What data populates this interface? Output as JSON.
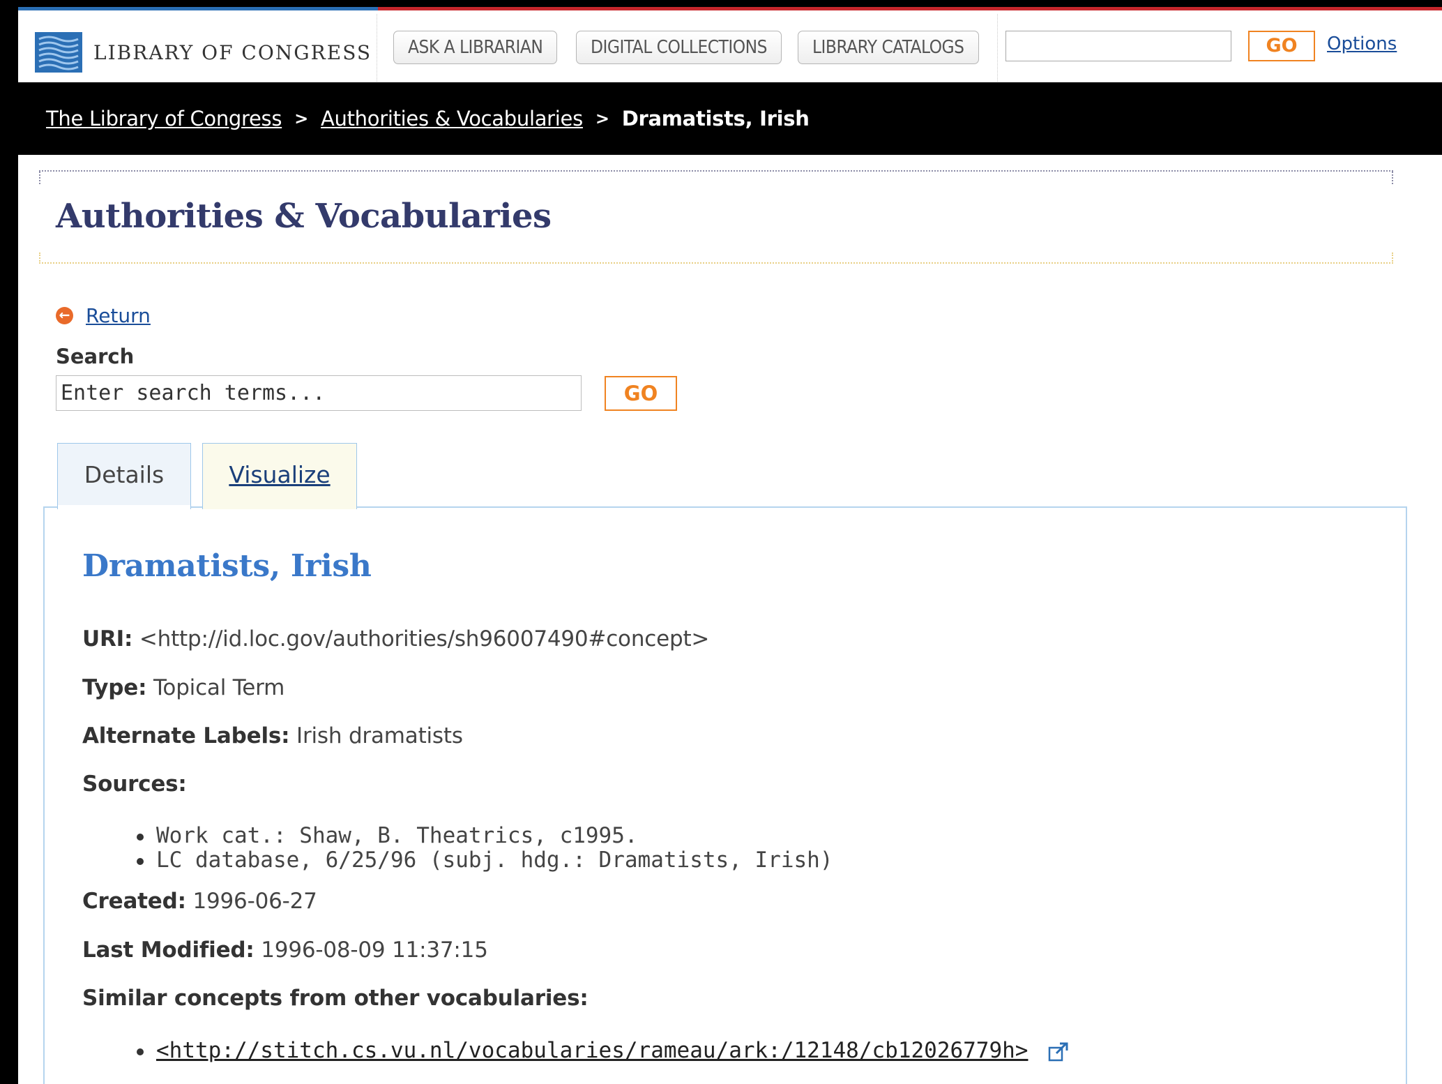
{
  "header": {
    "logo_text": "LIBRARY OF CONGRESS",
    "nav": [
      "ASK A LIBRARIAN",
      "DIGITAL COLLECTIONS",
      "LIBRARY CATALOGS"
    ],
    "search_value": "",
    "go_label": "GO",
    "options_label": "Options"
  },
  "breadcrumb": {
    "items": [
      "The Library of Congress",
      "Authorities & Vocabularies"
    ],
    "separator": ">",
    "current": "Dramatists, Irish"
  },
  "page": {
    "title": "Authorities & Vocabularies",
    "return_label": "Return",
    "search_label": "Search",
    "search_placeholder": "Enter search terms...",
    "go_label": "GO"
  },
  "tabs": {
    "details": "Details",
    "visualize": "Visualize"
  },
  "record": {
    "title": "Dramatists, Irish",
    "uri_label": "URI:",
    "uri_value": "<http://id.loc.gov/authorities/sh96007490#concept>",
    "type_label": "Type:",
    "type_value": "Topical Term",
    "alt_label": "Alternate Labels:",
    "alt_value": "Irish dramatists",
    "sources_label": "Sources:",
    "sources": [
      "Work cat.: Shaw, B. Theatrics, c1995.",
      "LC database, 6/25/96 (subj. hdg.: Dramatists, Irish)"
    ],
    "created_label": "Created:",
    "created_value": "1996-06-27",
    "modified_label": "Last Modified:",
    "modified_value": "1996-08-09 11:37:15",
    "similar_label": "Similar concepts from other vocabularies:",
    "similar": [
      "<http://stitch.cs.vu.nl/vocabularies/rameau/ark:/12148/cb12026779h>"
    ]
  },
  "colors": {
    "accent_orange": "#f08321",
    "link_blue": "#1a4d99",
    "title_navy": "#333a6b",
    "term_blue": "#3a78c9"
  }
}
